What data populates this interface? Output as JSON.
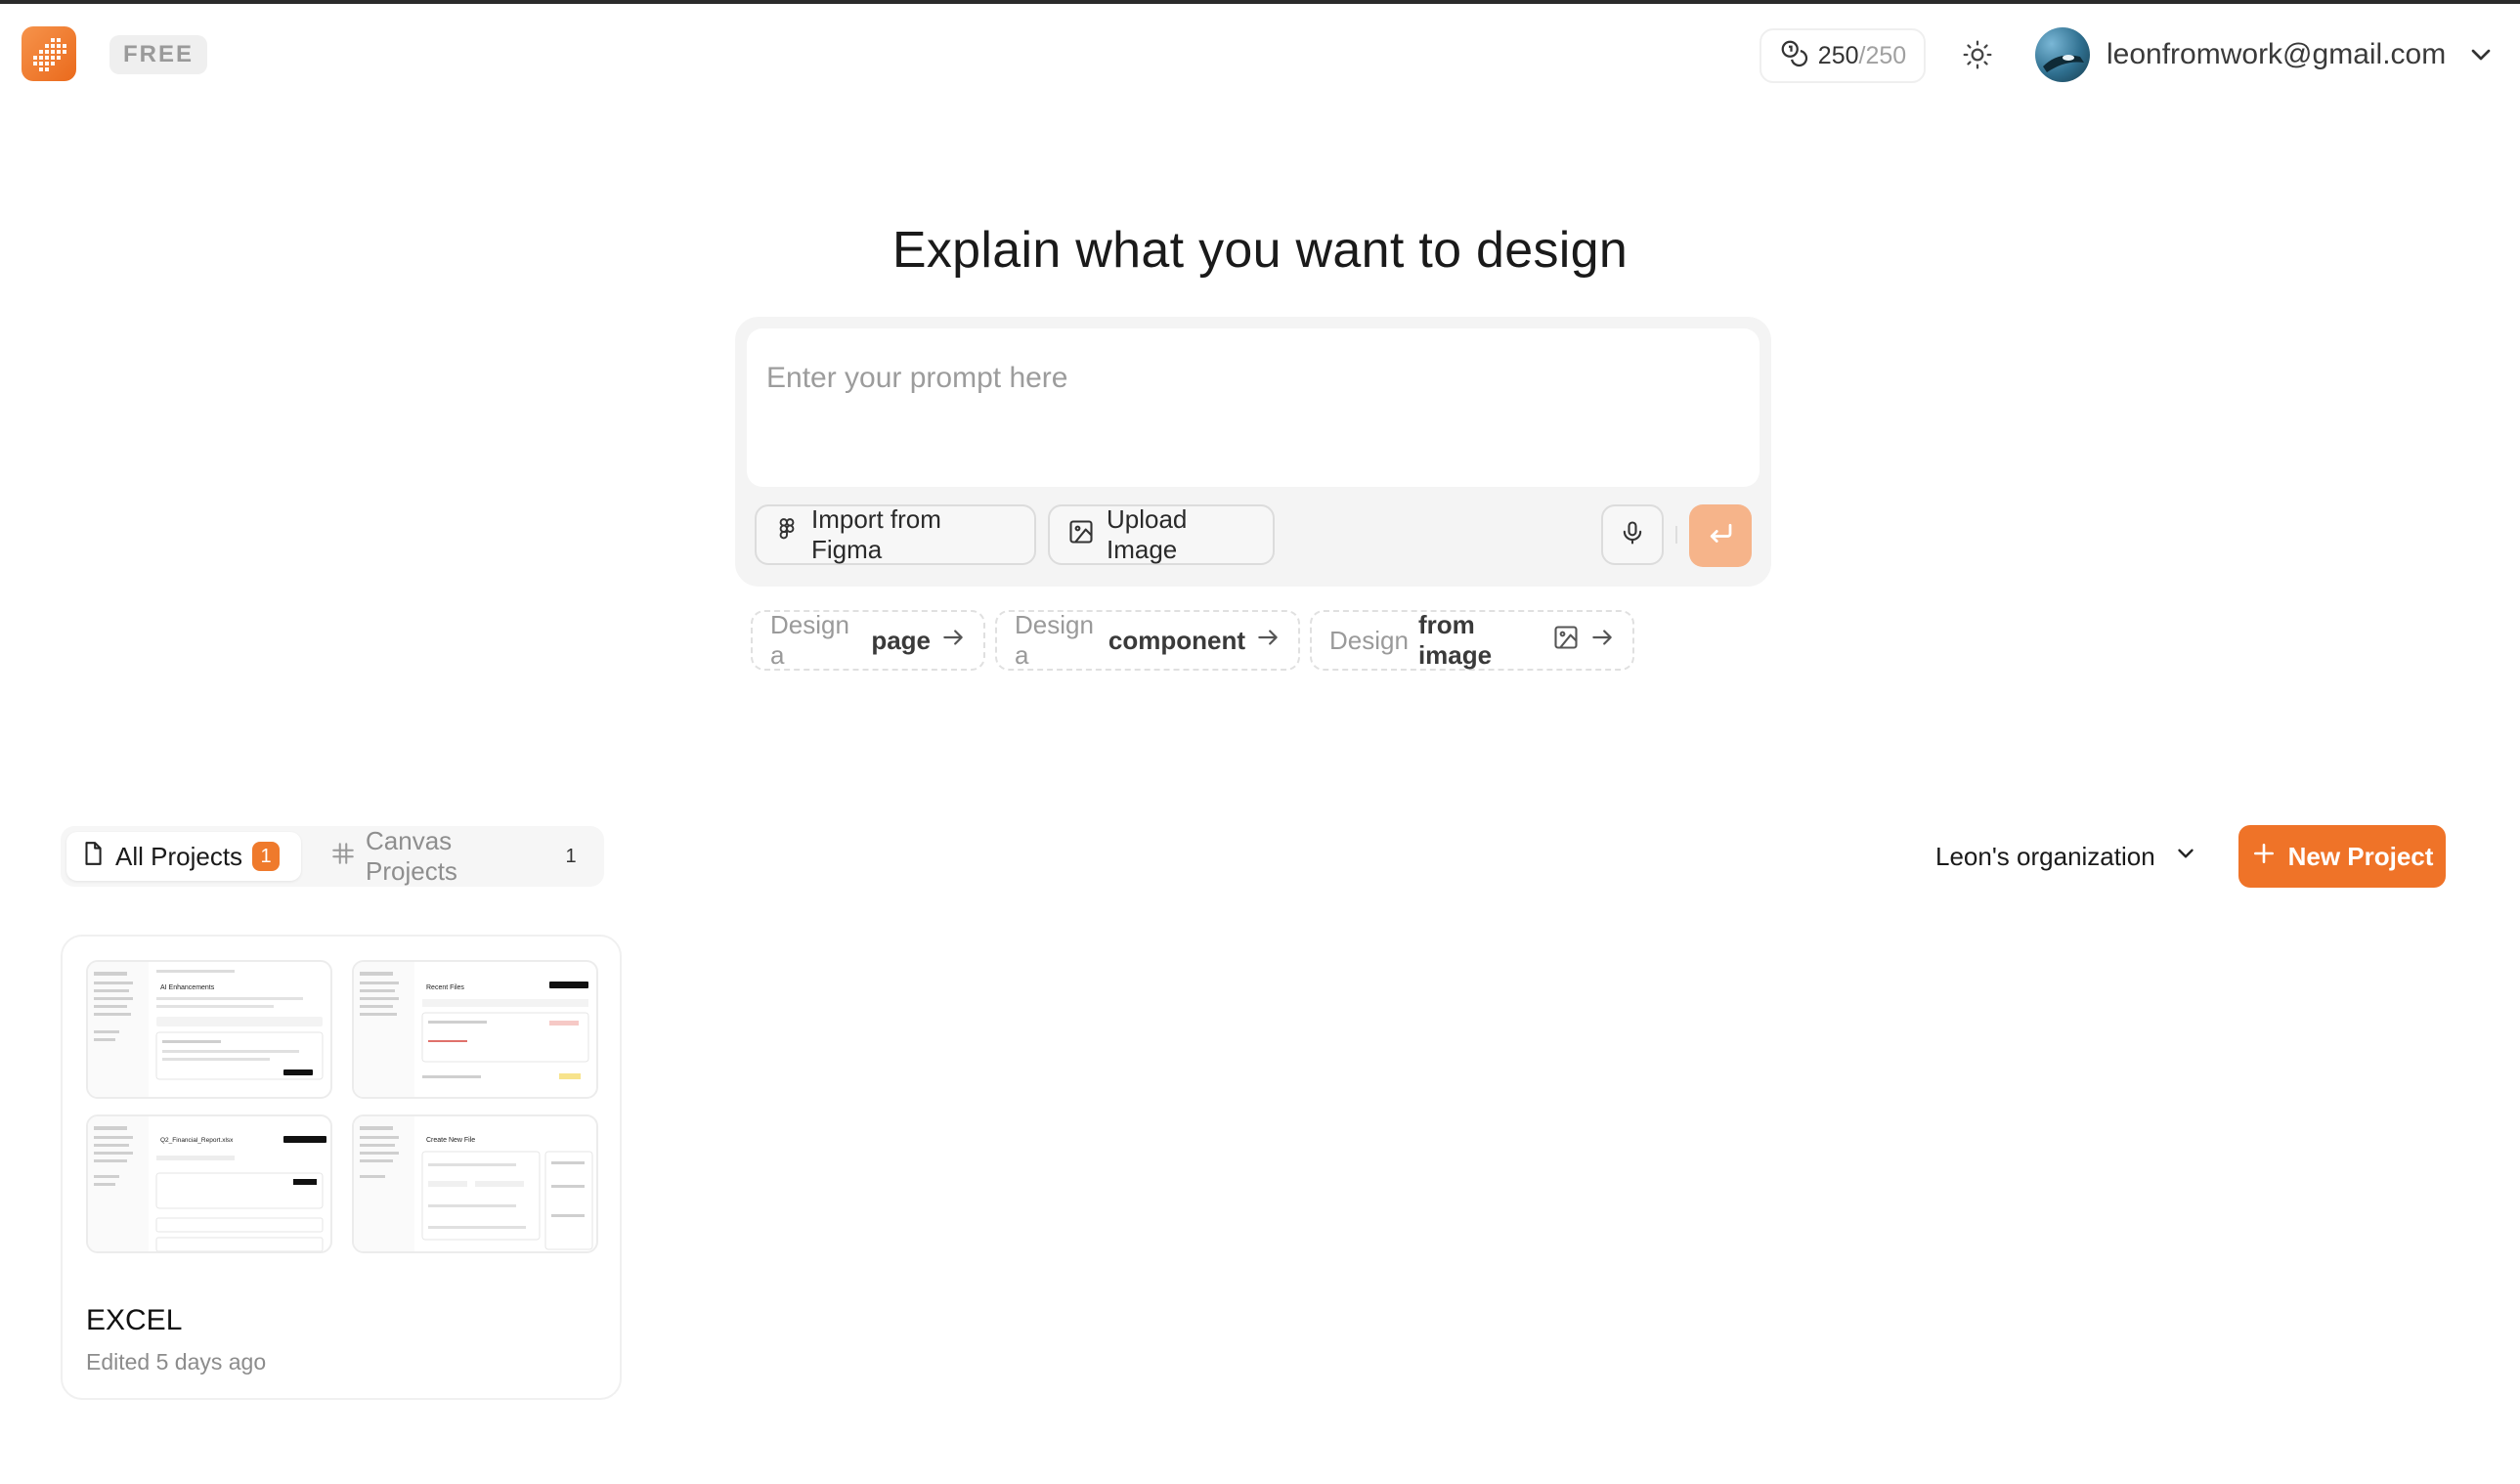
{
  "header": {
    "plan_badge": "FREE",
    "credits_used": "250",
    "credits_total": "/250",
    "credits_icon": "coins-icon",
    "theme_icon": "sun-icon",
    "user_email": "leonfromwork@gmail.com",
    "brand_color": "#ef7328"
  },
  "composer": {
    "headline": "Explain what you want to design",
    "placeholder": "Enter your prompt here",
    "import_figma_label": "Import from Figma",
    "upload_image_label": "Upload Image",
    "mic_icon": "microphone-icon",
    "send_icon": "enter-icon"
  },
  "suggestions": [
    {
      "prefix": "Design a",
      "emphasis": "page"
    },
    {
      "prefix": "Design a",
      "emphasis": "component"
    },
    {
      "prefix": "Design",
      "emphasis": "from image"
    }
  ],
  "projects": {
    "tabs": [
      {
        "label": "All Projects",
        "count": "1",
        "active": true
      },
      {
        "label": "Canvas Projects",
        "count": "1",
        "active": false
      }
    ],
    "organization": "Leon's organization",
    "new_project_label": "New Project",
    "items": [
      {
        "name": "EXCEL",
        "meta": "Edited 5 days ago",
        "thumbnails": [
          "AI Enhancements",
          "Recent Files",
          "Q2_Financial_Report.xlsx",
          "Create New File"
        ]
      }
    ]
  }
}
